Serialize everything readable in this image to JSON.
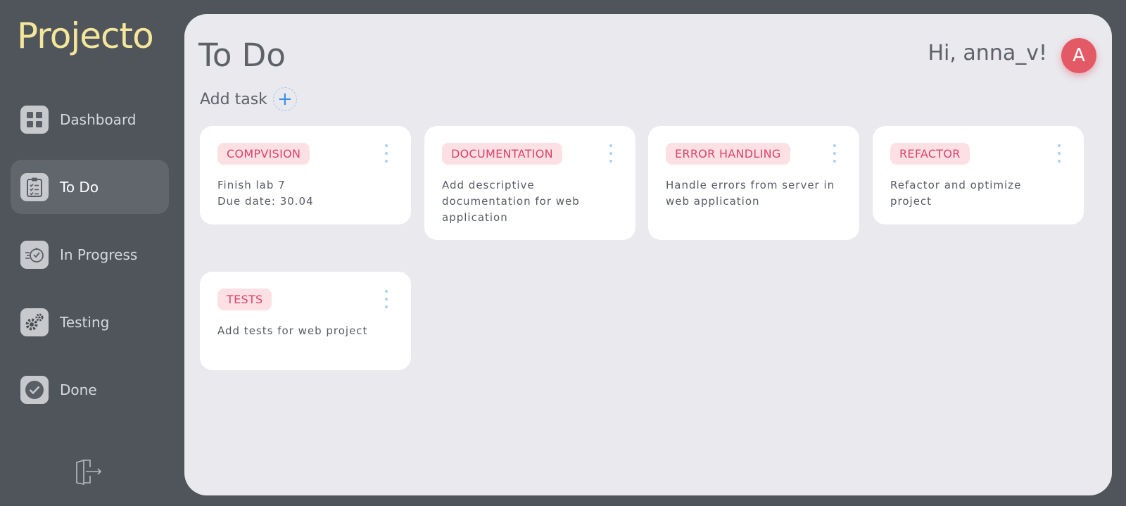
{
  "app": {
    "logo": "Projecto"
  },
  "sidebar": {
    "items": [
      {
        "label": "Dashboard",
        "icon": "dashboard-icon",
        "active": false
      },
      {
        "label": "To Do",
        "icon": "clipboard-icon",
        "active": true
      },
      {
        "label": "In Progress",
        "icon": "stopwatch-icon",
        "active": false
      },
      {
        "label": "Testing",
        "icon": "gears-icon",
        "active": false
      },
      {
        "label": "Done",
        "icon": "check-icon",
        "active": false
      }
    ],
    "logout_icon": "logout-icon"
  },
  "header": {
    "title": "To Do",
    "greeting": "Hi, anna_v!",
    "avatar_letter": "A"
  },
  "add_task": {
    "label": "Add task",
    "icon": "+"
  },
  "colors": {
    "accent": "#e35a66",
    "tag_bg": "#fde0e4",
    "tag_text": "#d9436a",
    "logo": "#f4e69a"
  },
  "cards": [
    {
      "tag": "COMPVISION",
      "text": "Finish lab 7\nDue date: 30.04"
    },
    {
      "tag": "DOCUMENTATION",
      "text": "Add descriptive documentation for web application"
    },
    {
      "tag": "ERROR HANDLING",
      "text": "Handle errors from server in web application"
    },
    {
      "tag": "REFACTOR",
      "text": "Refactor and optimize project"
    },
    {
      "tag": "TESTS",
      "text": "Add tests for web project"
    }
  ]
}
